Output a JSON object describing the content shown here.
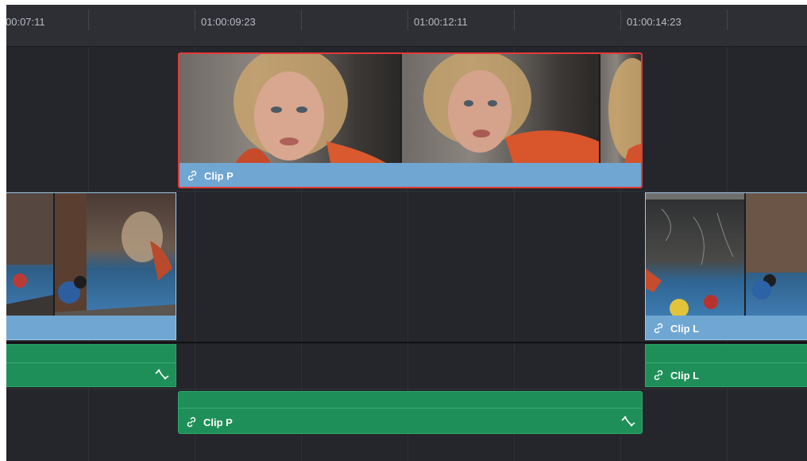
{
  "ruler": {
    "timecodes": [
      "00:07:11",
      "01:00:09:23",
      "01:00:12:11",
      "01:00:14:23"
    ]
  },
  "tracks": {
    "v2_clip": {
      "name": "Clip P",
      "selected": true
    },
    "v1_left_clip": {
      "name": "",
      "selected": false
    },
    "v1_right_clip": {
      "name": "Clip L",
      "selected": false
    },
    "a1_left_clip": {
      "name": "",
      "selected": false
    },
    "a1_right_clip": {
      "name": "Clip L",
      "selected": false
    },
    "a2_clip": {
      "name": "Clip P",
      "selected": true
    }
  },
  "colors": {
    "timeline_bg": "#25262b",
    "video_clip": "#6fa6d2",
    "audio_clip": "#1f8f59",
    "selection": "#e43a3a"
  },
  "icons": {
    "link": "link-icon",
    "keyframe": "audio-curve-icon"
  }
}
